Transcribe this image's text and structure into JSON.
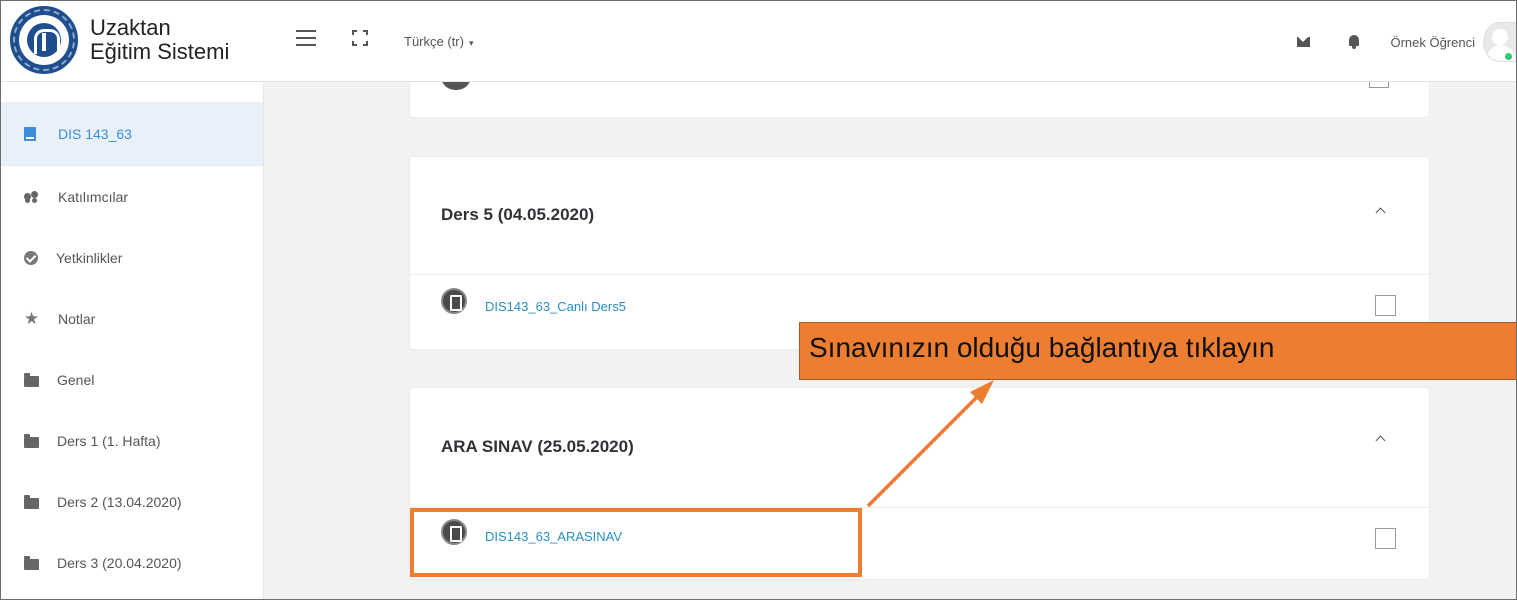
{
  "brand": {
    "line1": "Uzaktan",
    "line2": "Eğitim Sistemi"
  },
  "navbar": {
    "language": "Türkçe (tr)",
    "language_caret": "▾",
    "user_name": "Örnek Öğrenci"
  },
  "sidebar": {
    "items": [
      {
        "label": "DIS 143_63",
        "icon": "book-icon",
        "active": true
      },
      {
        "label": "Katılımcılar",
        "icon": "users-icon"
      },
      {
        "label": "Yetkinlikler",
        "icon": "check-circle-icon"
      },
      {
        "label": "Notlar",
        "icon": "star-icon"
      },
      {
        "label": "Genel",
        "icon": "folder-icon"
      },
      {
        "label": "Ders 1 (1. Hafta)",
        "icon": "folder-icon"
      },
      {
        "label": "Ders 2 (13.04.2020)",
        "icon": "folder-icon"
      },
      {
        "label": "Ders 3 (20.04.2020)",
        "icon": "folder-icon"
      }
    ]
  },
  "sections": [
    {
      "title": "Ders 5 (04.05.2020)",
      "activity": {
        "label": "DIS143_63_Canlı Ders5",
        "icon": "live-lesson-icon"
      }
    },
    {
      "title": "ARA SINAV (25.05.2020)",
      "activity": {
        "label": "DIS143_63_ARASINAV",
        "icon": "quiz-icon"
      }
    }
  ],
  "annotation": {
    "text": "Sınavınızın olduğu bağlantıya tıklayın",
    "color": "#ed7d31"
  },
  "colors": {
    "accent": "#3e8ddd",
    "link": "#2a8ec4",
    "annotation": "#ed7d31"
  }
}
